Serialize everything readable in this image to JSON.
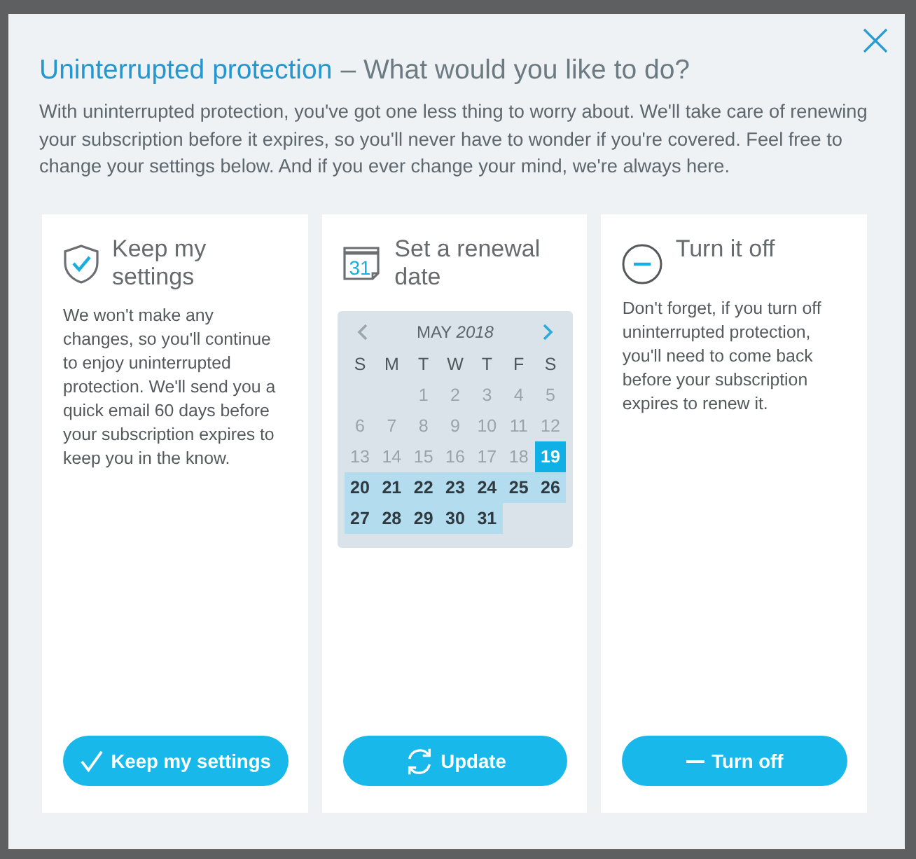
{
  "heading": {
    "product": "Uninterrupted protection",
    "question": "– What would you like to do?"
  },
  "intro": "With uninterrupted protection, you've got one less thing to worry about. We'll take care of renewing your subscription before it expires, so you'll never have to wonder if you're covered. Feel free to change your settings below. And if you ever change your mind, we're always here.",
  "cards": [
    {
      "kind": "keep",
      "title": "Keep my settings",
      "text": "We won't make any changes, so you'll continue to enjoy uninterrupted protection. We'll send you a quick email 60 days before your subscription expires to keep you in the know.",
      "button": "Keep my settings"
    },
    {
      "kind": "calendar",
      "title": "Set a renewal date",
      "icon_label": "31",
      "calendar": {
        "month": "MAY *2018*",
        "prev": {
          "disabled": true
        },
        "next": {
          "disabled": false
        },
        "weekdays": [
          "S",
          "M",
          "T",
          "W",
          "T",
          "F",
          "S"
        ],
        "weeks": [
          [
            {
              "kind": "blank"
            },
            {
              "kind": "blank"
            },
            {
              "kind": "day",
              "label": "1",
              "disabled": true,
              "selected": false,
              "highlighted": false
            },
            {
              "kind": "day",
              "label": "2",
              "disabled": true,
              "selected": false,
              "highlighted": false
            },
            {
              "kind": "day",
              "label": "3",
              "disabled": true,
              "selected": false,
              "highlighted": false
            },
            {
              "kind": "day",
              "label": "4",
              "disabled": true,
              "selected": false,
              "highlighted": false
            },
            {
              "kind": "day",
              "label": "5",
              "disabled": true,
              "selected": false,
              "highlighted": false
            }
          ],
          [
            {
              "kind": "day",
              "label": "6",
              "disabled": true,
              "selected": false,
              "highlighted": false
            },
            {
              "kind": "day",
              "label": "7",
              "disabled": true,
              "selected": false,
              "highlighted": false
            },
            {
              "kind": "day",
              "label": "8",
              "disabled": true,
              "selected": false,
              "highlighted": false
            },
            {
              "kind": "day",
              "label": "9",
              "disabled": true,
              "selected": false,
              "highlighted": false
            },
            {
              "kind": "day",
              "label": "10",
              "disabled": true,
              "selected": false,
              "highlighted": false
            },
            {
              "kind": "day",
              "label": "11",
              "disabled": true,
              "selected": false,
              "highlighted": false
            },
            {
              "kind": "day",
              "label": "12",
              "disabled": true,
              "selected": false,
              "highlighted": false
            }
          ],
          [
            {
              "kind": "day",
              "label": "13",
              "disabled": true,
              "selected": false,
              "highlighted": false
            },
            {
              "kind": "day",
              "label": "14",
              "disabled": true,
              "selected": false,
              "highlighted": false
            },
            {
              "kind": "day",
              "label": "15",
              "disabled": true,
              "selected": false,
              "highlighted": false
            },
            {
              "kind": "day",
              "label": "16",
              "disabled": true,
              "selected": false,
              "highlighted": false
            },
            {
              "kind": "day",
              "label": "17",
              "disabled": true,
              "selected": false,
              "highlighted": false
            },
            {
              "kind": "day",
              "label": "18",
              "disabled": true,
              "selected": false,
              "highlighted": false
            },
            {
              "kind": "day",
              "label": "19",
              "disabled": false,
              "selected": true,
              "highlighted": false
            }
          ],
          [
            {
              "kind": "day",
              "label": "20",
              "disabled": false,
              "selected": false,
              "highlighted": true
            },
            {
              "kind": "day",
              "label": "21",
              "disabled": false,
              "selected": false,
              "highlighted": true
            },
            {
              "kind": "day",
              "label": "22",
              "disabled": false,
              "selected": false,
              "highlighted": true
            },
            {
              "kind": "day",
              "label": "23",
              "disabled": false,
              "selected": false,
              "highlighted": true
            },
            {
              "kind": "day",
              "label": "24",
              "disabled": false,
              "selected": false,
              "highlighted": true
            },
            {
              "kind": "day",
              "label": "25",
              "disabled": false,
              "selected": false,
              "highlighted": true
            },
            {
              "kind": "day",
              "label": "26",
              "disabled": false,
              "selected": false,
              "highlighted": true
            }
          ],
          [
            {
              "kind": "day",
              "label": "27",
              "disabled": false,
              "selected": false,
              "highlighted": true
            },
            {
              "kind": "day",
              "label": "28",
              "disabled": false,
              "selected": false,
              "highlighted": true
            },
            {
              "kind": "day",
              "label": "29",
              "disabled": false,
              "selected": false,
              "highlighted": true
            },
            {
              "kind": "day",
              "label": "30",
              "disabled": false,
              "selected": false,
              "highlighted": true
            },
            {
              "kind": "day",
              "label": "31",
              "disabled": false,
              "selected": false,
              "highlighted": true
            },
            {
              "kind": "blank"
            },
            {
              "kind": "blank"
            }
          ]
        ]
      },
      "button": "Update"
    },
    {
      "kind": "off",
      "title": "Turn it off",
      "text": "Don't forget, if you turn off uninterrupted protection, you'll need to come back before your subscription expires to renew it.",
      "button": "Turn off"
    }
  ]
}
